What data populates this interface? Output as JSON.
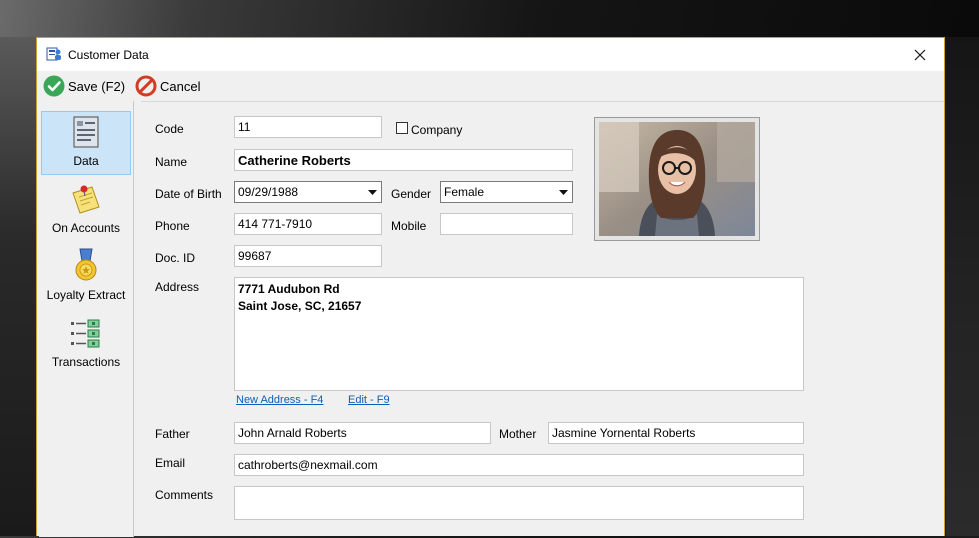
{
  "window": {
    "title": "Customer Data"
  },
  "toolbar": {
    "save_label": "Save (F2)",
    "cancel_label": "Cancel"
  },
  "sidebar": {
    "items": [
      {
        "label": "Data",
        "icon": "document-list-icon",
        "active": true
      },
      {
        "label": "On Accounts",
        "icon": "pinned-note-icon",
        "active": false
      },
      {
        "label": "Loyalty Extract",
        "icon": "medal-icon",
        "active": false
      },
      {
        "label": "Transactions",
        "icon": "transactions-list-icon",
        "active": false
      }
    ]
  },
  "form": {
    "code": {
      "label": "Code",
      "value": "11"
    },
    "company": {
      "label": "Company",
      "checked": false
    },
    "name": {
      "label": "Name",
      "value": "Catherine Roberts"
    },
    "dob": {
      "label": "Date of Birth",
      "value": "09/29/1988"
    },
    "gender": {
      "label": "Gender",
      "value": "Female"
    },
    "phone": {
      "label": "Phone",
      "value": "414 771-7910"
    },
    "mobile": {
      "label": "Mobile",
      "value": ""
    },
    "doc_id": {
      "label": "Doc. ID",
      "value": "99687"
    },
    "address": {
      "label": "Address",
      "value": "7771 Audubon Rd\nSaint Jose, SC, 21657"
    },
    "address_links": {
      "new_address": "New Address - F4",
      "edit": "Edit - F9"
    },
    "father": {
      "label": "Father",
      "value": "John Arnald Roberts"
    },
    "mother": {
      "label": "Mother",
      "value": "Jasmine Yornental Roberts"
    },
    "email": {
      "label": "Email",
      "value": "cathroberts@nexmail.com"
    },
    "comments": {
      "label": "Comments",
      "value": ""
    }
  },
  "colors": {
    "accent_border": "#c9a227",
    "selected_bg": "#cce4f7",
    "link": "#0b5fb8"
  }
}
